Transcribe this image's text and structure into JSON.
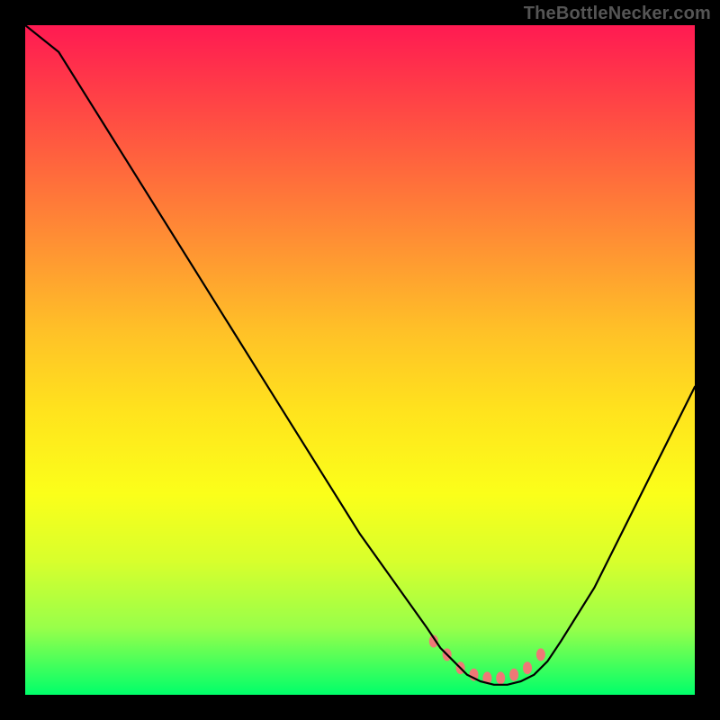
{
  "attribution": "TheBottleNecker.com",
  "chart_data": {
    "type": "line",
    "title": "",
    "xlabel": "",
    "ylabel": "",
    "xlim": [
      0,
      100
    ],
    "ylim": [
      0,
      100
    ],
    "x": [
      0,
      5,
      10,
      15,
      20,
      25,
      30,
      35,
      40,
      45,
      50,
      55,
      60,
      62,
      64,
      66,
      68,
      70,
      72,
      74,
      76,
      78,
      80,
      85,
      90,
      95,
      100
    ],
    "values": [
      100,
      96,
      88,
      80,
      72,
      64,
      56,
      48,
      40,
      32,
      24,
      17,
      10,
      7,
      5,
      3,
      2,
      1.5,
      1.5,
      2,
      3,
      5,
      8,
      16,
      26,
      36,
      46
    ],
    "markers": {
      "x": [
        61,
        63,
        65,
        67,
        69,
        71,
        73,
        75,
        77
      ],
      "values": [
        8,
        6,
        4,
        3,
        2.5,
        2.5,
        3,
        4,
        6
      ]
    }
  }
}
